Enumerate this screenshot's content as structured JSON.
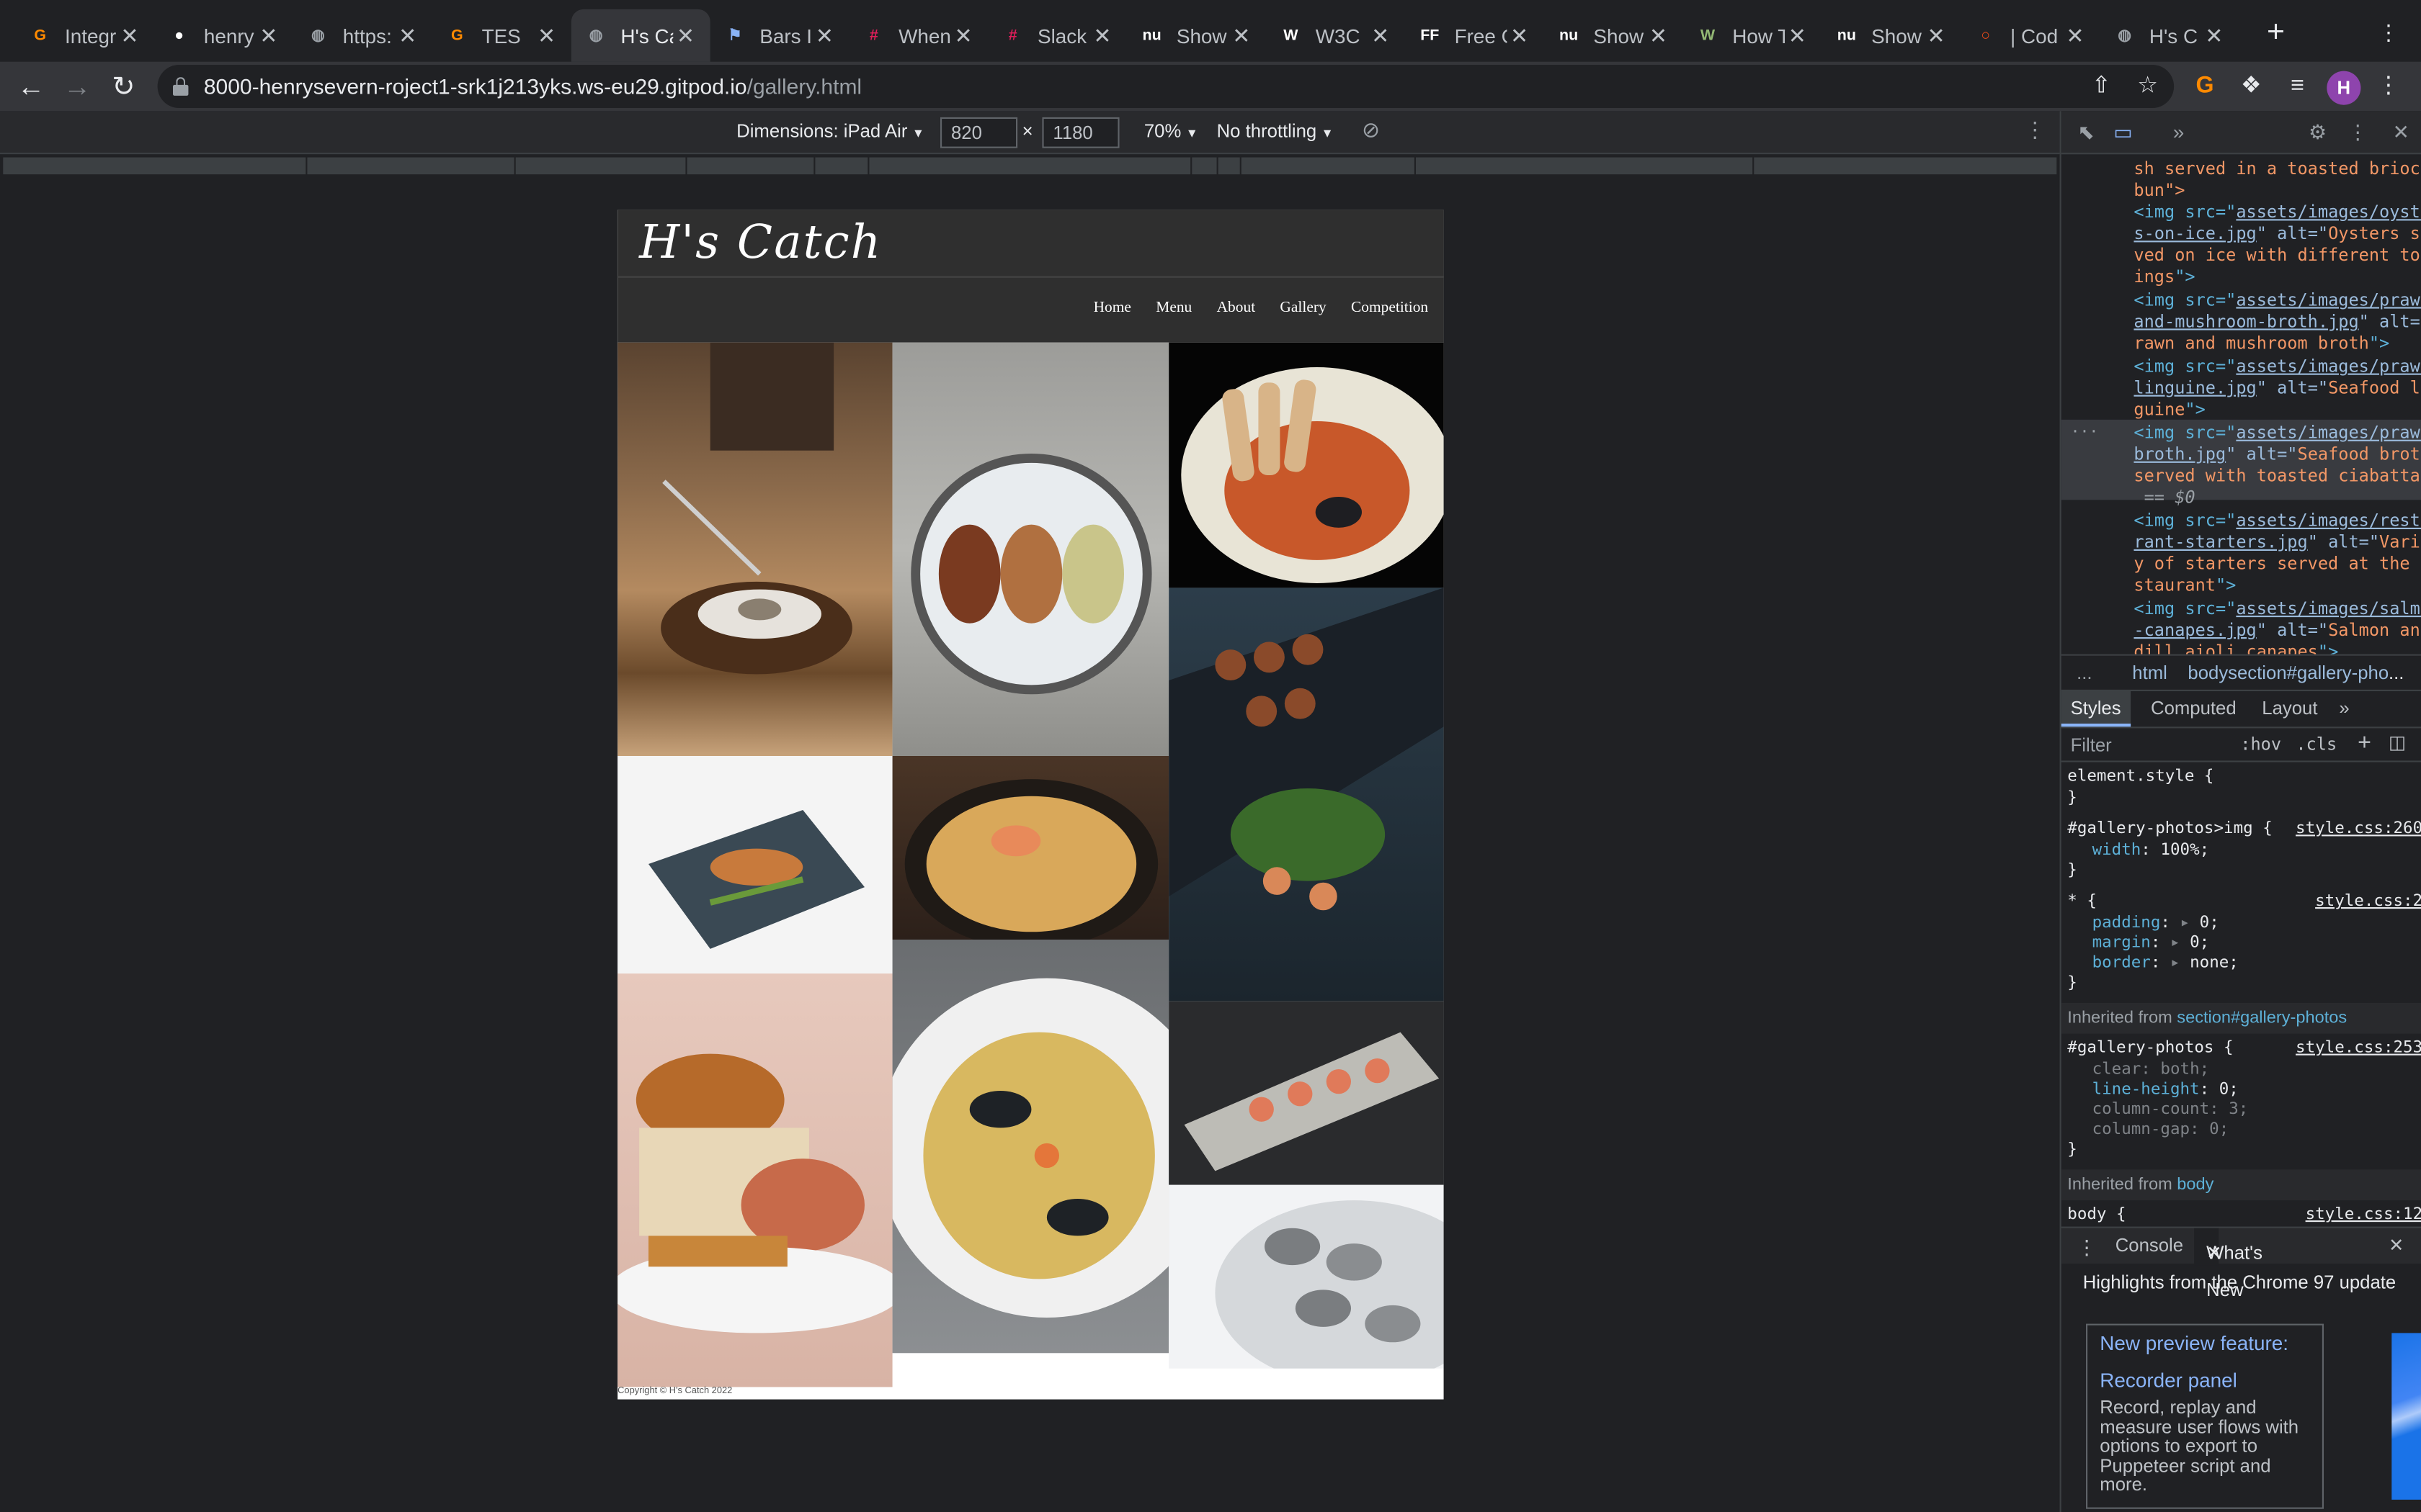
{
  "tabs": [
    {
      "label": "Integr",
      "icon": "gitpod-icon",
      "color": "#ff8a00"
    },
    {
      "label": "henry",
      "icon": "github-icon",
      "color": "#ffffff"
    },
    {
      "label": "https:",
      "icon": "globe-icon",
      "color": "#9aa0a6"
    },
    {
      "label": "TES",
      "icon": "gitpod-icon",
      "color": "#ff8a00"
    },
    {
      "label": "H's Ca",
      "icon": "globe-icon",
      "color": "#9aa0a6",
      "active": true
    },
    {
      "label": "Bars I",
      "icon": "flag-icon",
      "color": "#8ab4f8"
    },
    {
      "label": "When",
      "icon": "slack-icon",
      "color": "#e01e5a"
    },
    {
      "label": "Slack",
      "icon": "slack-icon",
      "color": "#e01e5a"
    },
    {
      "label": "Show",
      "icon": "nu-icon",
      "color": "#ffffff"
    },
    {
      "label": "W3C",
      "icon": "w3c-icon",
      "color": "#ffffff"
    },
    {
      "label": "Free C",
      "icon": "ff-icon",
      "color": "#ffffff"
    },
    {
      "label": "Show",
      "icon": "nu-icon",
      "color": "#ffffff"
    },
    {
      "label": "How T",
      "icon": "wikihow-icon",
      "color": "#93b874"
    },
    {
      "label": "Show",
      "icon": "nu-icon",
      "color": "#ffffff"
    },
    {
      "label": "| Cod",
      "icon": "codeinstitute-icon",
      "color": "#e64a19"
    },
    {
      "label": "H's C",
      "icon": "globe-icon",
      "color": "#9aa0a6"
    }
  ],
  "omnibox": {
    "host": "8000-henrysevern-roject1-srk1j213yks.ws-eu29.gitpod.io",
    "path": "/gallery.html"
  },
  "profile_initial": "H",
  "device_toolbar": {
    "dimensions_label": "Dimensions: iPad Air",
    "width": "820",
    "times": "×",
    "height": "1180",
    "zoom": "70%",
    "throttling": "No throttling"
  },
  "site": {
    "title": "H's Catch",
    "nav": [
      "Home",
      "Menu",
      "About",
      "Gallery",
      "Competition"
    ],
    "copyright": "Copyright © H's Catch 2022"
  },
  "gallery_photos": [
    {
      "alt": "Chef plating an oyster with tweezers",
      "color": "#7a5a3a"
    },
    {
      "alt": "Oysters served on ice with different toppings",
      "color": "#a7a7a4"
    },
    {
      "alt": "Seafood broth served with toasted ciabatta",
      "color": "#c46a3a"
    },
    {
      "alt": "Fish fillet on slate plate",
      "color": "#2c3b46"
    },
    {
      "alt": "Prawn and mushroom broth",
      "color": "#c49650"
    },
    {
      "alt": "Scallops and prawn skewers on slate",
      "color": "#1e2b33"
    },
    {
      "alt": "Lobster roll served in a toasted brioche bun",
      "color": "#d9b8a8"
    },
    {
      "alt": "Seafood linguine",
      "color": "#b59a56"
    },
    {
      "alt": "Salmon and dill aioli canapes",
      "color": "#55595e"
    },
    {
      "alt": "Oysters on ice",
      "color": "#c9ccd0"
    }
  ],
  "devtools": {
    "dom_lines": [
      {
        "text": "sh served in a toasted brioche"
      },
      {
        "text": "bun\">"
      },
      {
        "pre": "<img src=\"",
        "link": "assets/images/oyster",
        "post": ""
      },
      {
        "link2": "s-on-ice.jpg",
        "mid": "\" alt=\"",
        "val": "Oysters ser"
      },
      {
        "val": "ved on ice with different topp"
      },
      {
        "val": "ings",
        "post": "\">"
      },
      {
        "pre": "<img src=\"",
        "link": "assets/images/prawn-",
        "post": ""
      },
      {
        "link2": "and-mushroom-broth.jpg",
        "mid": "\" alt=\"",
        "val": "P"
      },
      {
        "val": "rawn and mushroom broth",
        "post": "\">"
      },
      {
        "pre": "<img src=\"",
        "link": "assets/images/prawn-",
        "post": ""
      },
      {
        "link2": "linguine.jpg",
        "mid": "\" alt=\"",
        "val": "Seafood lin"
      },
      {
        "val": "guine",
        "post": "\">"
      },
      {
        "pre": "<img src=\"",
        "link": "assets/images/prawn-",
        "post": ""
      },
      {
        "link2": "broth.jpg",
        "mid": "\" alt=\"",
        "val": "Seafood broth"
      },
      {
        "val": "served with toasted ciabatta",
        "post": "\">"
      },
      {
        "eq": " == $0"
      },
      {
        "pre": "<img src=\"",
        "link": "assets/images/restau",
        "post": ""
      },
      {
        "link2": "rant-starters.jpg",
        "mid": "\" alt=\"",
        "val": "Variet"
      },
      {
        "val": "y of starters served at the re"
      },
      {
        "val": "staurant",
        "post": "\">"
      },
      {
        "pre": "<img src=\"",
        "link": "assets/images/salmon",
        "post": ""
      },
      {
        "link2": "-canapes.jpg",
        "mid": "\" alt=\"",
        "val": "Salmon and"
      },
      {
        "val": "dill aioli canapes",
        "post": "\">"
      }
    ],
    "breadcrumbs": [
      "...",
      "html",
      "body",
      "section#gallery-pho",
      "..."
    ],
    "panel_tabs": [
      "Styles",
      "Computed",
      "Layout",
      "»"
    ],
    "filter_placeholder": "Filter",
    "hov": ":hov",
    "cls": ".cls",
    "styles": {
      "element_style": "element.style {",
      "rule1_selector": "#gallery-photos>img {",
      "rule1_source": "style.css:260",
      "rule1_prop": "width",
      "rule1_value": "100%;",
      "rule2_selector": "* {",
      "rule2_source": "style.css:2",
      "rule2_props": [
        {
          "name": "padding",
          "value": "0;"
        },
        {
          "name": "margin",
          "value": "0;"
        },
        {
          "name": "border",
          "value": "none;"
        }
      ],
      "inherited1_label": "Inherited from",
      "inherited1_target": "section#gallery-photos",
      "rule3_selector": "#gallery-photos {",
      "rule3_source": "style.css:253",
      "rule3_props": [
        {
          "name": "clear",
          "value": "both;",
          "faded": true
        },
        {
          "name": "line-height",
          "value": "0;",
          "faded": false
        },
        {
          "name": "column-count",
          "value": "3;",
          "faded": true
        },
        {
          "name": "column-gap",
          "value": "0;",
          "faded": true
        }
      ],
      "inherited2_label": "Inherited from",
      "inherited2_target": "body",
      "rule4_selector": "body {",
      "rule4_source": "style.css:12",
      "close_brace": "}"
    },
    "drawer_tabs": [
      "Console",
      "What's New"
    ],
    "highlights": "Highlights from the Chrome 97 update",
    "card": {
      "heading1": "New preview feature:",
      "heading2": "Recorder panel",
      "body": "Record, replay and measure user flows with options to export to Puppeteer script and more."
    }
  }
}
